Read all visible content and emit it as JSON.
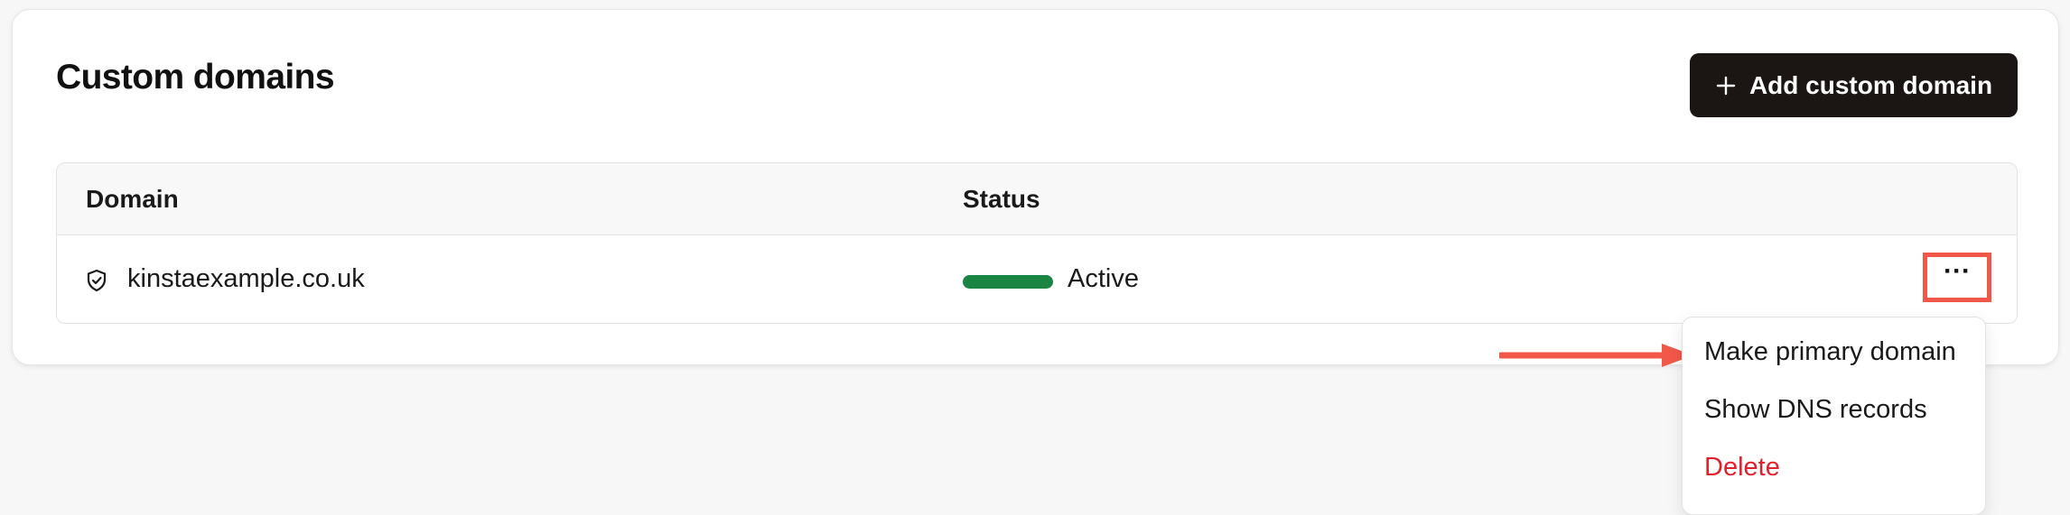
{
  "page": {
    "title": "Custom domains"
  },
  "toolbar": {
    "add_label": "Add custom domain",
    "add_icon": "plus-icon"
  },
  "table": {
    "columns": [
      "Domain",
      "Status"
    ],
    "rows": [
      {
        "domain": "kinstaexample.co.uk",
        "domain_icon": "shield-check-icon",
        "status": "Active",
        "status_color": "#1a8442"
      }
    ],
    "row_actions_icon": "more-horizontal-icon",
    "row_actions_label": "···"
  },
  "menu": {
    "items": [
      {
        "label": "Make primary domain"
      },
      {
        "label": "Show DNS records"
      },
      {
        "label": "Delete",
        "color": "#e0202b"
      }
    ]
  },
  "annotation": {
    "highlight_color": "#f2584a",
    "arrow_icon": "arrow-right-icon"
  },
  "colors": {
    "button_bg": "#1b1613",
    "page_bg": "#f7f7f7",
    "card_bg": "#ffffff"
  }
}
